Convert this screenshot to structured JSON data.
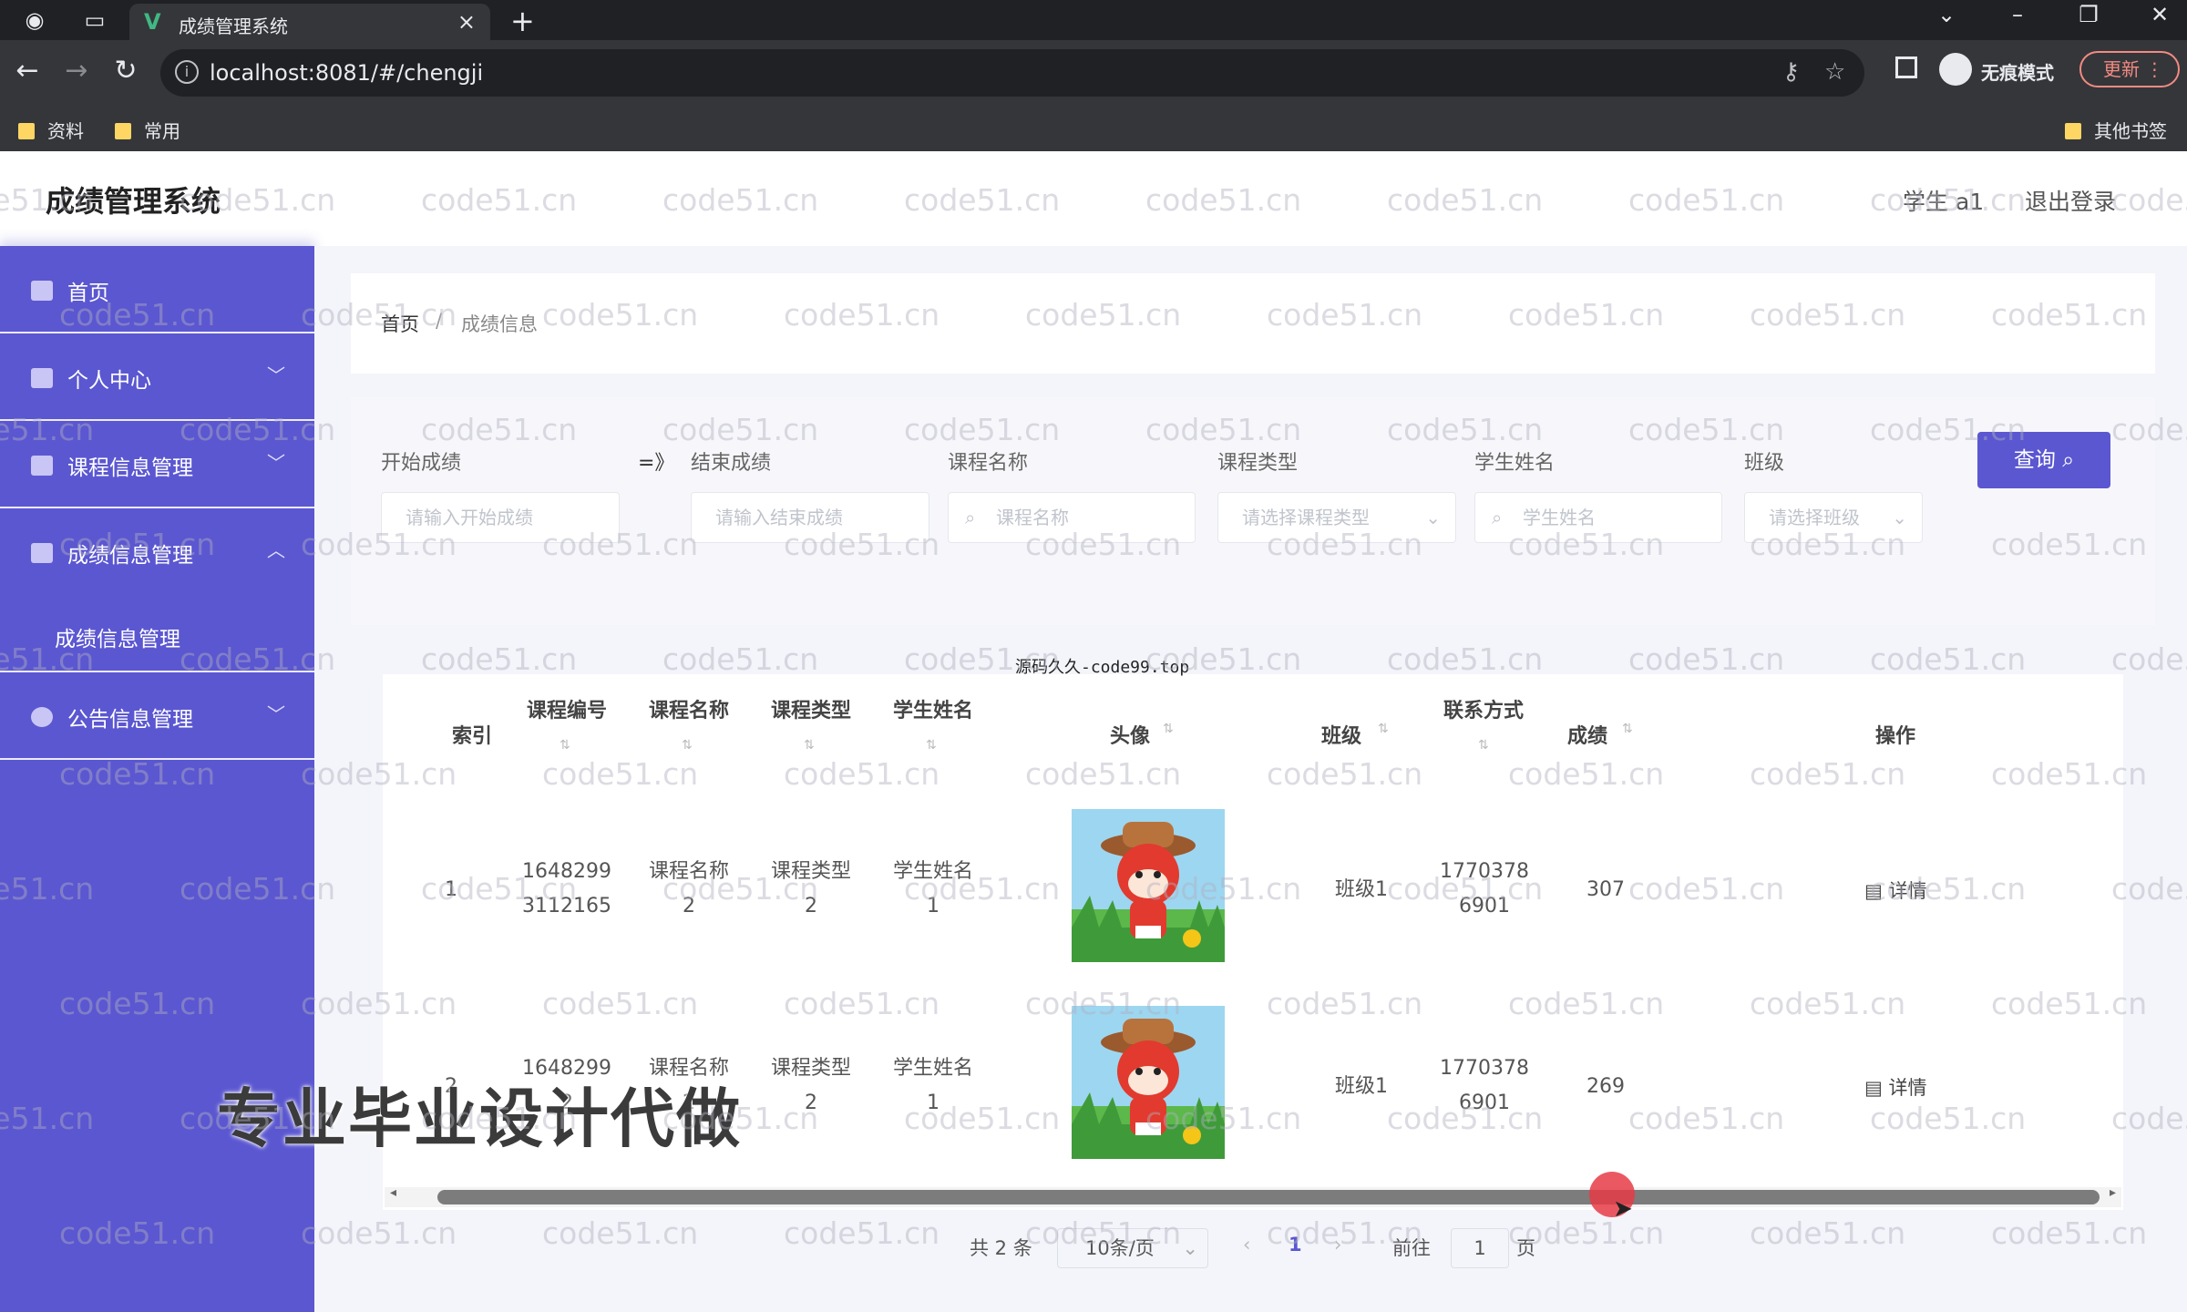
{
  "browser": {
    "tab_title": "成绩管理系统",
    "url": "localhost:8081/#/chengji",
    "incognito_label": "无痕模式",
    "update_label": "更新",
    "bookmarks": [
      "资料",
      "常用"
    ],
    "other_bookmarks": "其他书签"
  },
  "app": {
    "title": "成绩管理系统",
    "user": "学生 a1",
    "logout": "退出登录"
  },
  "sidebar": {
    "items": [
      {
        "label": "首页"
      },
      {
        "label": "个人中心"
      },
      {
        "label": "课程信息管理"
      },
      {
        "label": "成绩信息管理"
      },
      {
        "label": "公告信息管理"
      }
    ],
    "submenu": {
      "label": "成绩信息管理"
    }
  },
  "breadcrumb": {
    "home": "首页",
    "sep": "/",
    "current": "成绩信息"
  },
  "search": {
    "start_label": "开始成绩",
    "arrow": "=》",
    "end_label": "结束成绩",
    "course_label": "课程名称",
    "type_label": "课程类型",
    "student_label": "学生姓名",
    "class_label": "班级",
    "start_placeholder": "请输入开始成绩",
    "end_placeholder": "请输入结束成绩",
    "course_placeholder": "课程名称",
    "type_placeholder": "请选择课程类型",
    "student_placeholder": "学生姓名",
    "class_placeholder": "请选择班级",
    "query_button": "查询"
  },
  "table": {
    "headers": [
      "索引",
      "课程编号",
      "课程名称",
      "课程类型",
      "学生姓名",
      "头像",
      "班级",
      "联系方式",
      "成绩",
      "操作"
    ],
    "rows": [
      {
        "index": "1",
        "code": [
          "1648299",
          "3112165"
        ],
        "course": [
          "课程名称",
          "2"
        ],
        "type": [
          "课程类型",
          "2"
        ],
        "student": [
          "学生姓名",
          "1"
        ],
        "class": "班级1",
        "contact": [
          "1770378",
          "6901"
        ],
        "score": "307",
        "action": "详情"
      },
      {
        "index": "2",
        "code": [
          "1648299",
          "2"
        ],
        "course": [
          "课程名称",
          "2"
        ],
        "type": [
          "课程类型",
          "2"
        ],
        "student": [
          "学生姓名",
          "1"
        ],
        "class": "班级1",
        "contact": [
          "1770378",
          "6901"
        ],
        "score": "269",
        "action": "详情"
      }
    ]
  },
  "pagination": {
    "total": "共 2 条",
    "page_size": "10条/页",
    "current_page": "1",
    "goto": "前往",
    "goto_value": "1",
    "page_suffix": "页"
  },
  "overlay": {
    "promo": "专业毕业设计代做",
    "source": "源码久久-code99.top"
  },
  "watermark": "code51.cn",
  "colors": {
    "accent": "#5b57d1",
    "active_page": "#5b57d1"
  }
}
